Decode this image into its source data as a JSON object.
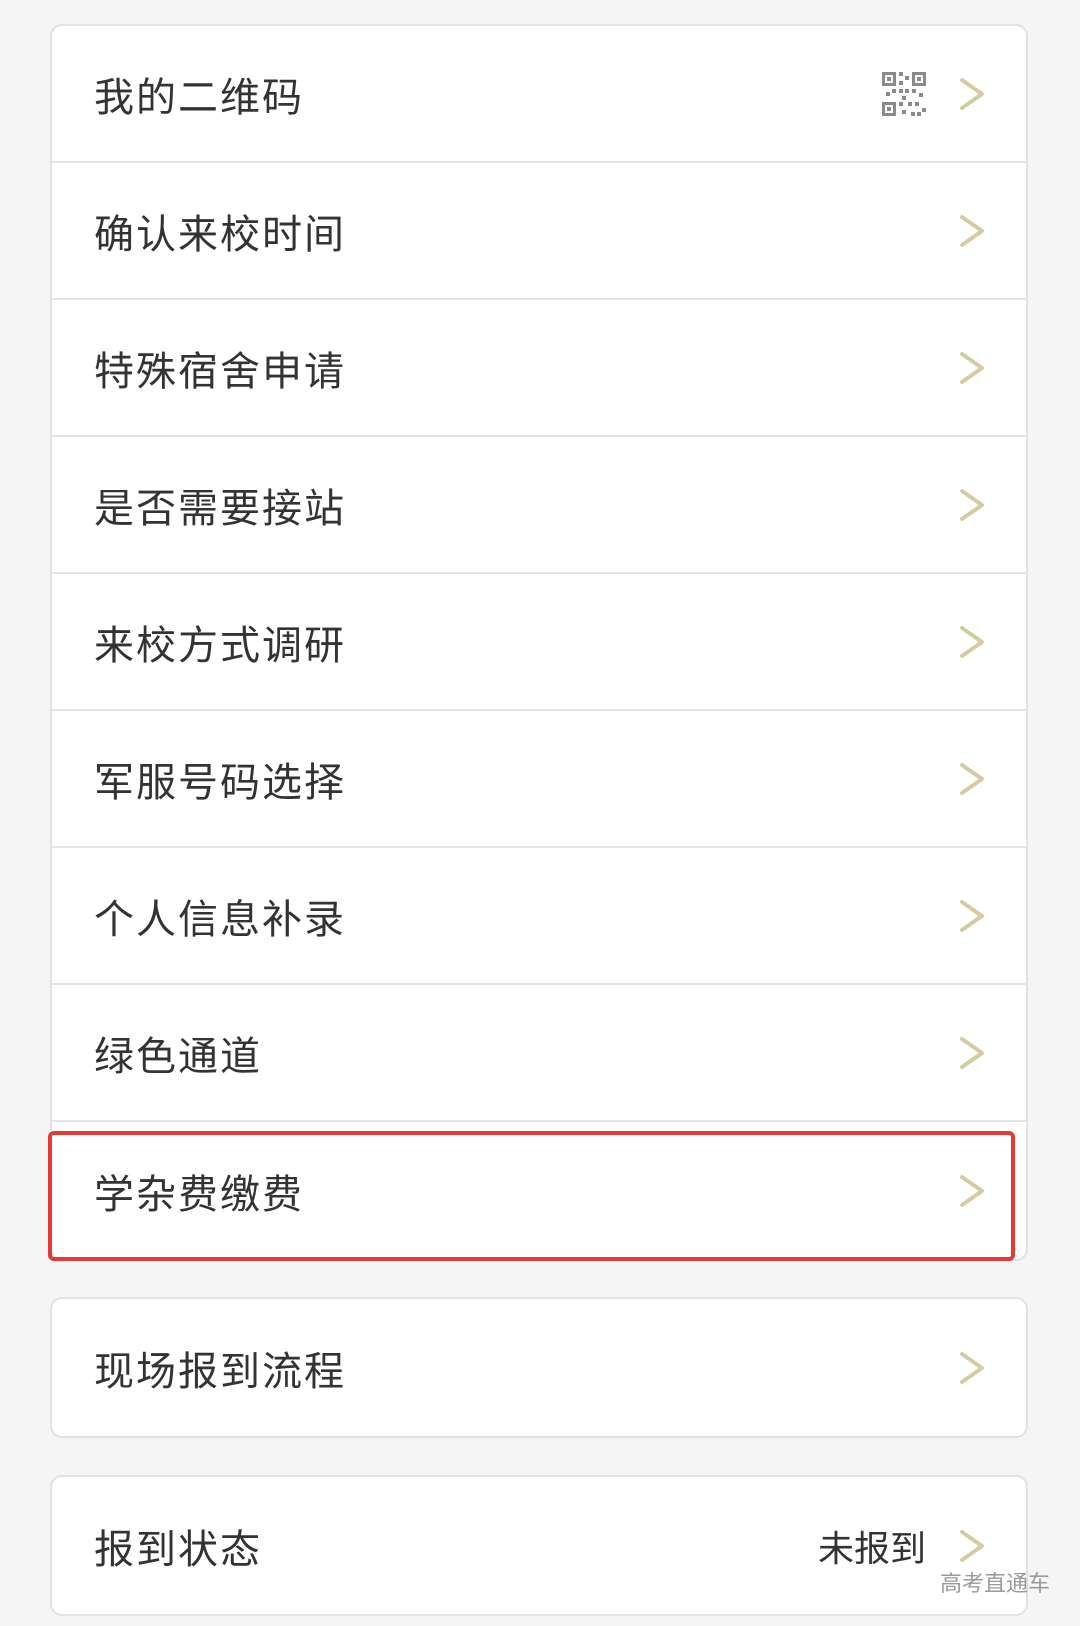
{
  "menu_group": {
    "items": [
      {
        "label": "我的二维码"
      },
      {
        "label": "确认来校时间"
      },
      {
        "label": "特殊宿舍申请"
      },
      {
        "label": "是否需要接站"
      },
      {
        "label": "来校方式调研"
      },
      {
        "label": "军服号码选择"
      },
      {
        "label": "个人信息补录"
      },
      {
        "label": "绿色通道"
      },
      {
        "label": "学杂费缴费"
      }
    ]
  },
  "process_group": {
    "items": [
      {
        "label": "现场报到流程"
      }
    ]
  },
  "status_group": {
    "label": "报到状态",
    "value": "未报到"
  },
  "watermark": "高考直通车",
  "colors": {
    "chevron": "#d4cca0",
    "highlight_border": "#e53935",
    "text": "#333333"
  },
  "icons": {
    "qr": "qr-code-icon",
    "chevron": "chevron-right-icon"
  }
}
